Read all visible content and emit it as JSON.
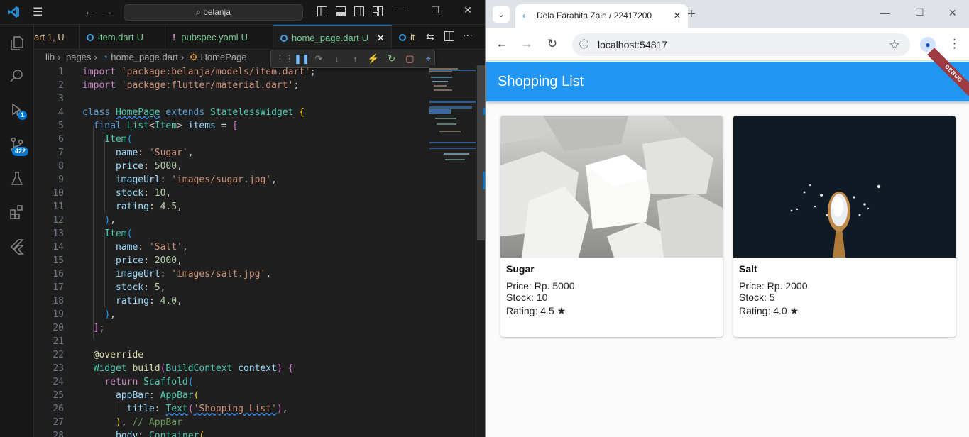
{
  "vscode": {
    "search": "belanja",
    "tabs": [
      {
        "label": "art 1, U"
      },
      {
        "label": "item.dart",
        "status": "U"
      },
      {
        "label": "pubspec.yaml",
        "status": "U"
      },
      {
        "label": "home_page.dart",
        "status": "U"
      },
      {
        "label": "it"
      }
    ],
    "breadcrumb": [
      "lib",
      "pages",
      "home_page.dart",
      "HomePage"
    ],
    "badges": {
      "run": "1",
      "scm": "422"
    },
    "line_numbers": [
      "1",
      "2",
      "3",
      "4",
      "5",
      "6",
      "7",
      "8",
      "9",
      "10",
      "11",
      "12",
      "13",
      "14",
      "15",
      "16",
      "17",
      "18",
      "19",
      "20",
      "21",
      "22",
      "23",
      "24",
      "25",
      "26",
      "27",
      "28"
    ]
  },
  "browser": {
    "tab_title": "Dela Farahita Zain / 22417200",
    "url": "localhost:54817",
    "app_title": "Shopping List",
    "debug_label": "DEBUG",
    "items": [
      {
        "name": "Sugar",
        "price": "Price: Rp. 5000",
        "stock": "Stock: 10",
        "rating": "Rating: 4.5 ★"
      },
      {
        "name": "Salt",
        "price": "Price: Rp. 2000",
        "stock": "Stock: 5",
        "rating": "Rating: 4.0 ★"
      }
    ]
  },
  "colors": {
    "appbar": "#2196f3",
    "vscode_bg": "#1f1f1f",
    "accent": "#0078d4"
  }
}
